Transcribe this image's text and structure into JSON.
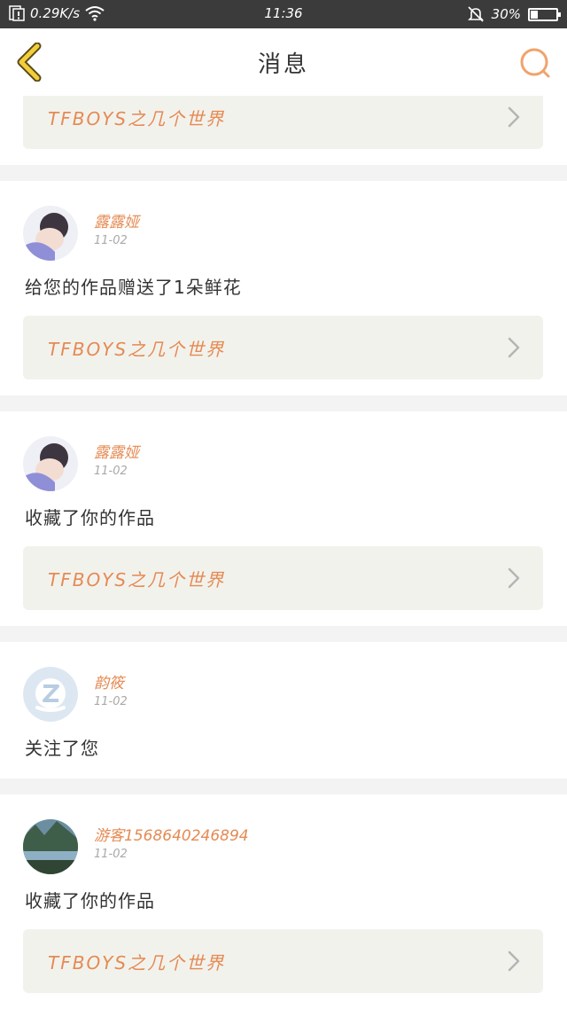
{
  "status_bar": {
    "speed": "0.29K/s",
    "time": "11:36",
    "battery": "30%",
    "battery_level": 0.3
  },
  "header": {
    "title": "消息",
    "back_icon": "chevron-left-icon",
    "search_icon": "search-icon"
  },
  "colors": {
    "accent": "#e58a52",
    "back_arrow": "#f2cf3a",
    "link_bg": "#f2f2ed"
  },
  "top_work_link": {
    "title": "TFBOYS之几个世界"
  },
  "messages": [
    {
      "user": "露露娅",
      "date": "11-02",
      "text": "给您的作品赠送了1朵鲜花",
      "work": "TFBOYS之几个世界"
    },
    {
      "user": "露露娅",
      "date": "11-02",
      "text": "收藏了你的作品",
      "work": "TFBOYS之几个世界"
    },
    {
      "user": "韵筱",
      "date": "11-02",
      "text": "关注了您"
    },
    {
      "user": "游客1568640246894",
      "date": "11-02",
      "text": "收藏了你的作品",
      "work": "TFBOYS之几个世界"
    }
  ]
}
